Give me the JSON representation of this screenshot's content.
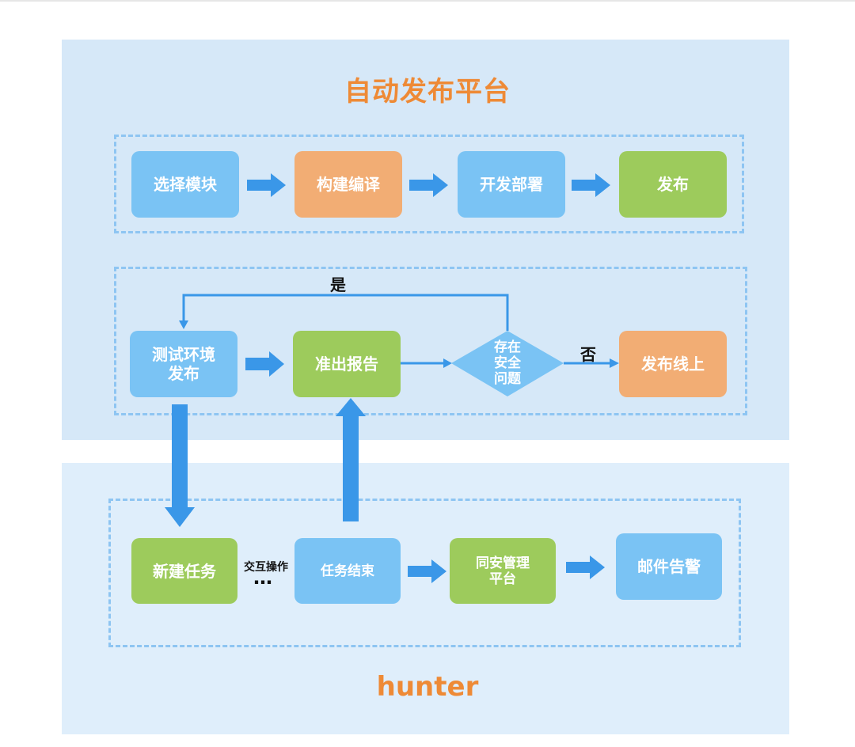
{
  "platform_title": "自动发布平台",
  "hunter_title": "hunter",
  "row1": {
    "select_module": "选择模块",
    "build_compile": "构建编译",
    "dev_deploy": "开发部署",
    "publish": "发布"
  },
  "row2": {
    "test_env_publish": "测试环境\n发布",
    "access_report": "准出报告",
    "decision": "存在\n安全\n问题",
    "yes_label": "是",
    "no_label": "否",
    "publish_online": "发布线上"
  },
  "row3": {
    "new_task": "新建任务",
    "interaction": "交互操作",
    "ellipsis": "…",
    "task_end": "任务结束",
    "tongan_platform": "同安管理\n平台",
    "email_alert": "邮件告警"
  },
  "colors": {
    "blue_box": "#7ac3f4",
    "orange_box": "#f2ad74",
    "green_box": "#9dcb5c",
    "arrow": "#3a97e8",
    "title": "#ee8a36"
  }
}
